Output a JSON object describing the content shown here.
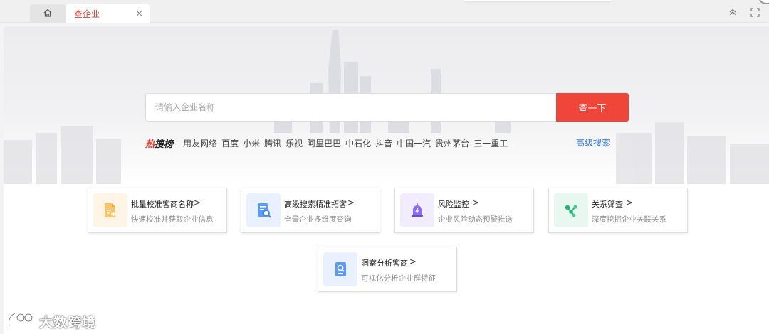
{
  "tabs": {
    "home_icon": "home-icon",
    "active_label": "查企业",
    "close_glyph": "×"
  },
  "search": {
    "placeholder": "请输入企业名称",
    "button_label": "查一下"
  },
  "hot": {
    "logo_prefix": "热",
    "logo_suffix": "搜榜",
    "items": [
      "用友网络",
      "百度",
      "小米",
      "腾讯",
      "乐视",
      "阿里巴巴",
      "中石化",
      "抖音",
      "中国一汽",
      "贵州茅台",
      "三一重工"
    ]
  },
  "advanced_search_label": "高级搜索",
  "features": [
    {
      "title": "批量校准客商名称",
      "desc": "快速校准并获取企业信息",
      "icon": "batch-doc-icon",
      "color": "#f5a623"
    },
    {
      "title": "高级搜索精准拓客",
      "desc": "全量企业多维度查询",
      "icon": "doc-search-icon",
      "color": "#3b82f6"
    },
    {
      "title": "风险监控",
      "desc": "企业风险动态预警推送",
      "icon": "alarm-bell-icon",
      "color": "#7c5cf0"
    },
    {
      "title": "关系筛查",
      "desc": "深度挖掘企业关联关系",
      "icon": "relation-graph-icon",
      "color": "#22b573"
    },
    {
      "title": "洞察分析客商",
      "desc": "可视化分析企业群特征",
      "icon": "insight-search-icon",
      "color": "#3b82f6"
    }
  ],
  "arrow_glyph": ">",
  "watermark_text": "大数跨境"
}
